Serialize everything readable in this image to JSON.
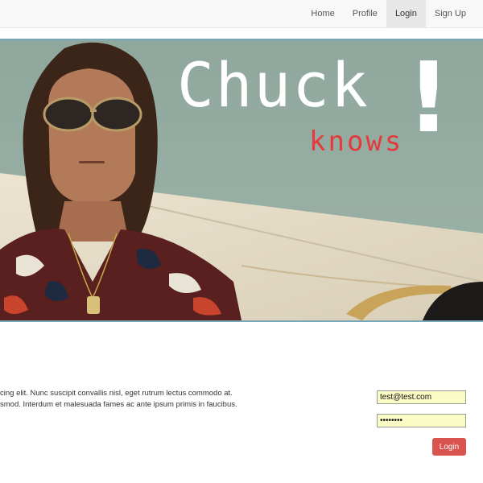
{
  "nav": {
    "items": [
      {
        "label": "Home",
        "active": false
      },
      {
        "label": "Profile",
        "active": false
      },
      {
        "label": "Login",
        "active": true
      },
      {
        "label": "Sign Up",
        "active": false
      }
    ]
  },
  "hero": {
    "title": "Chuck",
    "exclaim": "!",
    "subtitle": "knows",
    "subtitle_color": "#e53a3a"
  },
  "intro": {
    "line1": "cing elit. Nunc suscipit convallis nisl, eget rutrum lectus commodo at.",
    "line2": "smod. Interdum et malesuada fames ac ante ipsum primis in faucibus."
  },
  "login_form": {
    "email_value": "test@test.com",
    "password_value": "••••••••",
    "submit_label": "Login",
    "submit_color": "#d9534f"
  }
}
